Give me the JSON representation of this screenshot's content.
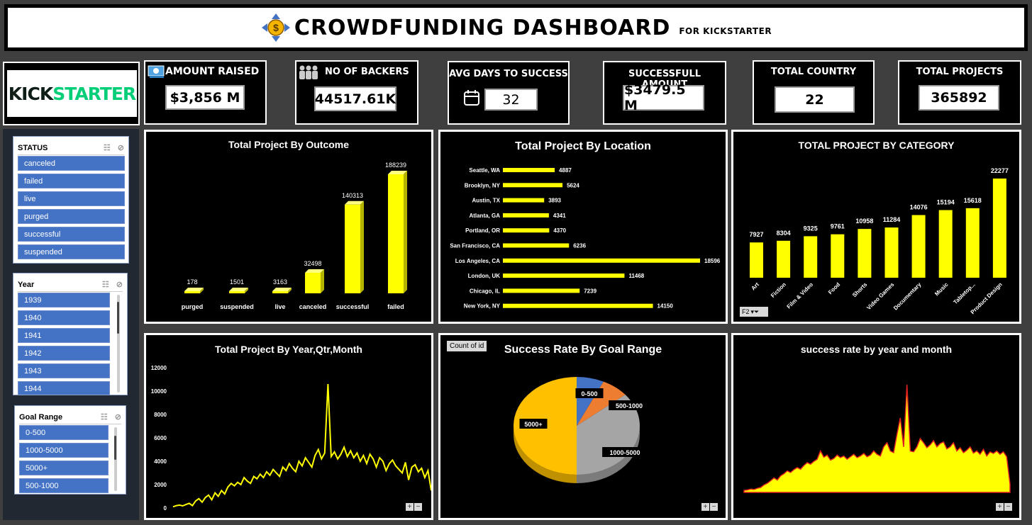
{
  "header": {
    "title": "CROWDFUNDING DASHBOARD",
    "subtitle": "FOR KICKSTARTER"
  },
  "logo": {
    "part1": "KICK",
    "part2": "STARTER"
  },
  "kpis": [
    {
      "title": "AMOUNT RAISED",
      "value": "$3,856 M",
      "icon": "money-icon"
    },
    {
      "title": "NO OF BACKERS",
      "value": "44517.61K",
      "icon": "people-icon"
    },
    {
      "title": "AVG DAYS TO SUCCESS",
      "value": "32",
      "icon": "calendar-icon"
    },
    {
      "title": "SUCCESSFULL AMOUNT",
      "value": "$3479.5 M"
    },
    {
      "title": "TOTAL COUNTRY",
      "value": "22"
    },
    {
      "title": "TOTAL PROJECTS",
      "value": "365892"
    }
  ],
  "slicers": {
    "status": {
      "title": "STATUS",
      "items": [
        "canceled",
        "failed",
        "live",
        "purged",
        "successful",
        "suspended"
      ]
    },
    "year": {
      "title": "Year",
      "items": [
        "1939",
        "1940",
        "1941",
        "1942",
        "1943",
        "1944"
      ]
    },
    "goal": {
      "title": "Goal Range",
      "items": [
        "0-500",
        "1000-5000",
        "5000+",
        "500-1000"
      ]
    }
  },
  "chart_data": [
    {
      "type": "bar",
      "title": "Total Project By Outcome",
      "categories": [
        "purged",
        "suspended",
        "live",
        "canceled",
        "successful",
        "failed"
      ],
      "values": [
        178,
        1501,
        3163,
        32498,
        140313,
        188239
      ],
      "color": "#ffff00"
    },
    {
      "type": "bar",
      "orientation": "horizontal",
      "title": "Total Project By Location",
      "categories": [
        "Seattle, WA",
        "Brooklyn, NY",
        "Austin, TX",
        "Atlanta, GA",
        "Portland, OR",
        "San Francisco, CA",
        "Los Angeles, CA",
        "London, UK",
        "Chicago, IL",
        "New York, NY"
      ],
      "values": [
        4887,
        5624,
        3893,
        4341,
        4370,
        6236,
        18596,
        11468,
        7239,
        14150
      ],
      "color": "#ffff00"
    },
    {
      "type": "bar",
      "title": "TOTAL PROJECT BY CATEGORY",
      "categories": [
        "Art",
        "Fiction",
        "Film & Video",
        "Food",
        "Shorts",
        "Video Games",
        "Documentary",
        "Music",
        "Tabletop...",
        "Product Design"
      ],
      "values": [
        7927,
        8304,
        9325,
        9761,
        10958,
        11284,
        14076,
        15194,
        15618,
        22277
      ],
      "filter_label": "F2",
      "color": "#ffff00"
    },
    {
      "type": "line",
      "title": "Total Project By Year,Qtr,Month",
      "ylim": [
        0,
        12000
      ],
      "yticks": [
        "0",
        "2000",
        "4000",
        "6000",
        "8000",
        "10000",
        "12000"
      ],
      "values": [
        100,
        200,
        250,
        180,
        300,
        400,
        200,
        600,
        800,
        500,
        900,
        1100,
        700,
        1300,
        1000,
        1500,
        1200,
        1800,
        2100,
        1900,
        2200,
        2000,
        2600,
        2300,
        2100,
        2700,
        2500,
        2900,
        2600,
        3100,
        2800,
        3300,
        3000,
        2700,
        3500,
        3200,
        3800,
        3400,
        3100,
        4000,
        3600,
        4300,
        3900,
        3500,
        4500,
        5000,
        4200,
        4700,
        10600,
        4400,
        4800,
        4200,
        4600,
        5200,
        4400,
        4900,
        4300,
        4700,
        4000,
        4500,
        3800,
        4600,
        4200,
        3500,
        4300,
        4000,
        3200,
        3800,
        4100,
        3600,
        3300,
        3000,
        3900,
        2400,
        3500,
        3700,
        3100,
        3400,
        2600,
        3200,
        1500
      ]
    },
    {
      "type": "pie",
      "title": "Success Rate By Goal Range",
      "button_label": "Count of id",
      "categories": [
        "0-500",
        "500-1000",
        "1000-5000",
        "5000+"
      ],
      "values": [
        7,
        7,
        36,
        50
      ],
      "colors": [
        "#4472c4",
        "#ed7d31",
        "#a5a5a5",
        "#ffc000"
      ]
    },
    {
      "type": "area",
      "title": "success rate by year and month",
      "color": "#ffff00",
      "values": [
        0.5,
        0.6,
        0.8,
        0.7,
        1,
        1.2,
        1.8,
        2.2,
        2.8,
        3.5,
        3,
        4,
        4.5,
        5.2,
        4.8,
        5.5,
        6,
        5.6,
        6.5,
        7.2,
        6.8,
        7.5,
        8,
        10,
        8.5,
        9,
        7.8,
        8.2,
        9,
        8.4,
        8.8,
        8,
        8.6,
        9.2,
        8.4,
        8.8,
        9.4,
        8.6,
        9,
        10,
        9.2,
        8.8,
        11,
        12,
        10,
        9.6,
        14,
        18,
        11,
        26,
        10,
        9.8,
        11,
        13,
        12,
        10.8,
        11.5,
        12.5,
        11,
        11.8,
        12.2,
        10.5,
        11,
        12,
        10,
        10.8,
        9.6,
        10.2,
        11,
        9.5,
        10,
        9.2,
        10.4,
        8.8,
        9.8,
        9.4,
        10,
        9.2,
        9.8,
        8.6,
        2
      ]
    }
  ]
}
